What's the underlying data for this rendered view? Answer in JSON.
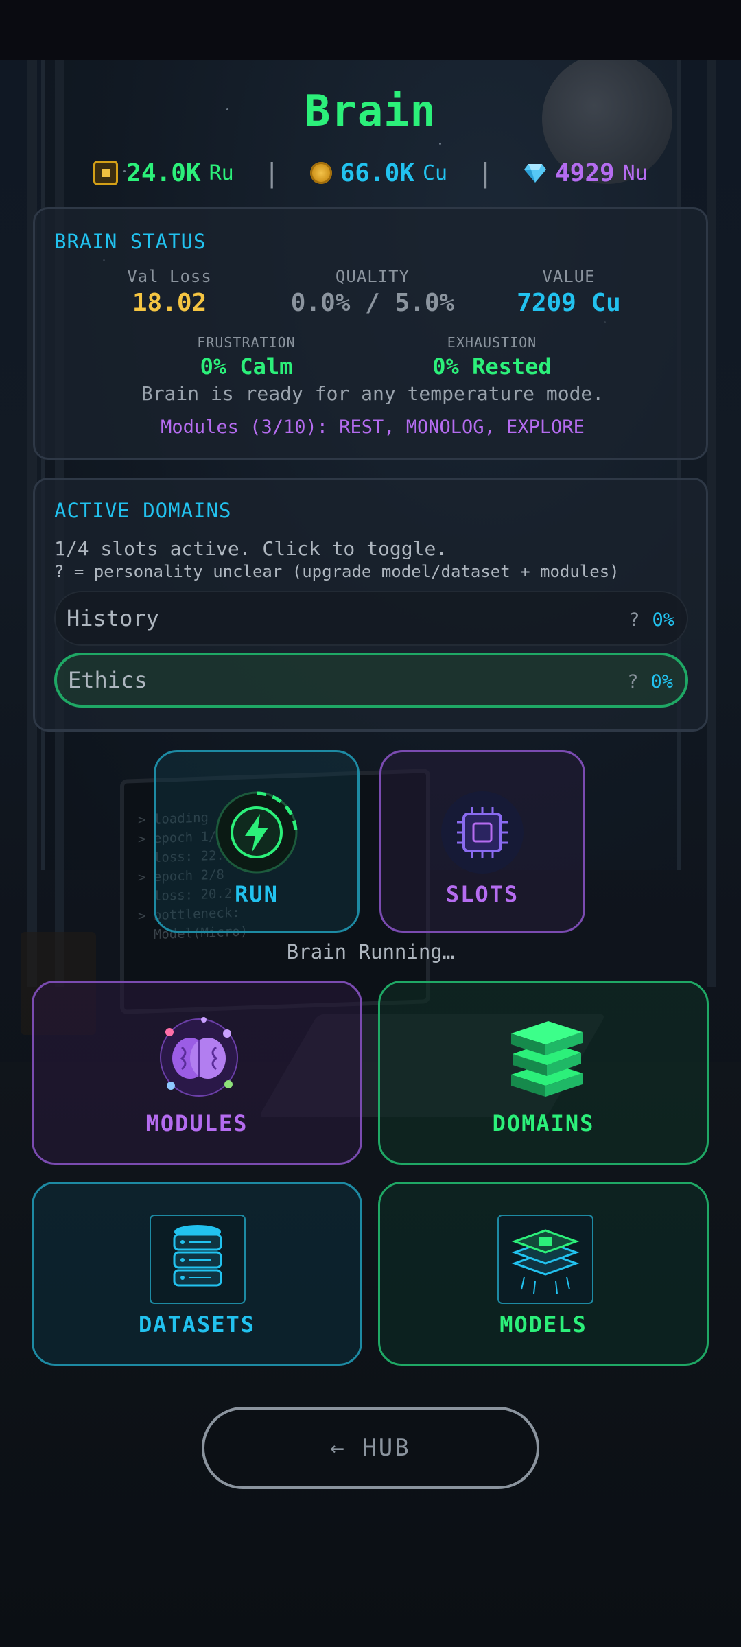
{
  "title": "Brain",
  "currencies": [
    {
      "value": "24.0K",
      "unit": "Ru",
      "color": "#2cf07a",
      "icon": "chip-icon"
    },
    {
      "value": "66.0K",
      "unit": "Cu",
      "color": "#22c2ef",
      "icon": "coin-icon"
    },
    {
      "value": "4929",
      "unit": "Nu",
      "color": "#b56cf0",
      "icon": "gem-icon"
    }
  ],
  "status": {
    "heading": "BRAIN STATUS",
    "val_loss": {
      "label": "Val Loss",
      "value": "18.02"
    },
    "quality": {
      "label": "QUALITY",
      "value": "0.0% / 5.0%"
    },
    "value": {
      "label": "VALUE",
      "value": "7209 Cu"
    },
    "frustration": {
      "label": "FRUSTRATION",
      "value": "0% Calm"
    },
    "exhaustion": {
      "label": "EXHAUSTION",
      "value": "0% Rested"
    },
    "message": "Brain is ready for any temperature mode.",
    "modules_line": "Modules (3/10): REST, MONOLOG, EXPLORE"
  },
  "domains": {
    "heading": "ACTIVE DOMAINS",
    "slots_text": "1/4 slots active. Click to toggle.",
    "hint": "? = personality unclear (upgrade model/dataset + modules)",
    "items": [
      {
        "name": "History",
        "q": "?",
        "pct": "0%",
        "active": false
      },
      {
        "name": "Ethics",
        "q": "?",
        "pct": "0%",
        "active": true
      }
    ]
  },
  "actions": {
    "run": "RUN",
    "slots": "SLOTS",
    "running_status": "Brain Running…",
    "modules": "MODULES",
    "domains": "DOMAINS",
    "datasets": "DATASETS",
    "models": "MODELS"
  },
  "hub": {
    "label": "← HUB"
  },
  "terminal_lines": "> loading\n> epoch 1/\n  loss: 22.\n> epoch 2/8\n  loss: 20.2\n> bottleneck:\n  Model(Micro)",
  "colors": {
    "green": "#2cf07a",
    "cyan": "#22c2ef",
    "purple": "#b56cf0",
    "yellow": "#f5c542",
    "gray": "#8b949e"
  }
}
